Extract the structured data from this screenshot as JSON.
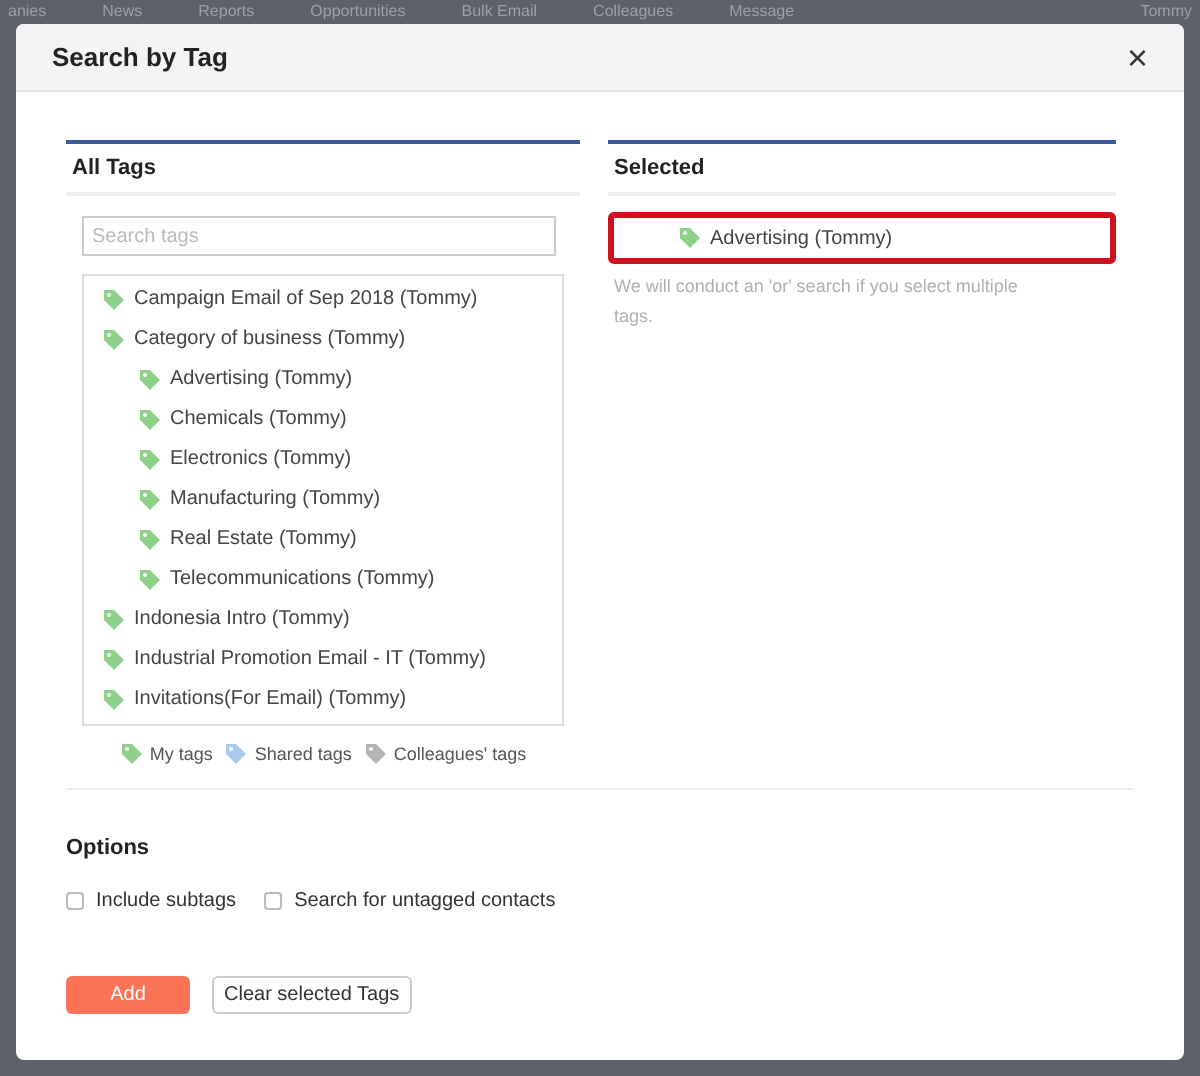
{
  "background_nav": {
    "items": [
      "anies",
      "News",
      "Reports",
      "Opportunities",
      "Bulk Email",
      "Colleagues",
      "Message"
    ],
    "user": "Tommy"
  },
  "dialog": {
    "title": "Search by Tag",
    "close": "×"
  },
  "all_tags": {
    "title": "All Tags",
    "search": {
      "placeholder": "Search tags"
    },
    "tree": [
      {
        "label": "Campaign Email of Sep 2018 (Tommy)"
      },
      {
        "label": "Category of business (Tommy)",
        "children": [
          {
            "label": "Advertising (Tommy)"
          },
          {
            "label": "Chemicals (Tommy)"
          },
          {
            "label": "Electronics (Tommy)"
          },
          {
            "label": "Manufacturing (Tommy)"
          },
          {
            "label": "Real Estate (Tommy)"
          },
          {
            "label": "Telecommunications (Tommy)"
          }
        ]
      },
      {
        "label": "Indonesia Intro (Tommy)"
      },
      {
        "label": "Industrial Promotion Email - IT (Tommy)"
      },
      {
        "label": "Invitations(For Email) (Tommy)"
      }
    ],
    "legend": [
      {
        "label": "My tags",
        "color": "#8fd18a"
      },
      {
        "label": "Shared tags",
        "color": "#a9c9ef"
      },
      {
        "label": "Colleagues' tags",
        "color": "#b5b5b5"
      }
    ]
  },
  "selected": {
    "title": "Selected",
    "items": [
      {
        "label": "Advertising (Tommy)",
        "highlighted": true
      }
    ],
    "hint": "We will conduct an 'or' search if you select multiple tags."
  },
  "options": {
    "title": "Options",
    "checkboxes": [
      {
        "label": "Include subtags",
        "checked": false
      },
      {
        "label": "Search for untagged contacts",
        "checked": false
      }
    ]
  },
  "buttons": [
    {
      "label": "Add",
      "kind": "primary"
    },
    {
      "label": "Clear selected Tags",
      "kind": "secondary"
    }
  ]
}
